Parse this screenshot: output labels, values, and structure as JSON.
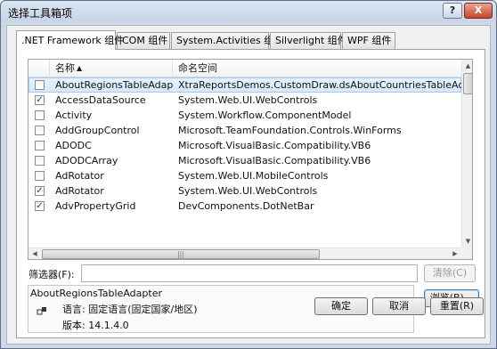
{
  "window": {
    "title": "选择工具箱项",
    "help": "?",
    "close": "X"
  },
  "tabs": [
    {
      "label": ".NET Framework 组件",
      "active": true
    },
    {
      "label": "COM 组件",
      "active": false
    },
    {
      "label": "System.Activities 组件",
      "active": false
    },
    {
      "label": "Silverlight 组件",
      "active": false
    },
    {
      "label": "WPF 组件",
      "active": false
    }
  ],
  "grid": {
    "columns": {
      "name": "名称",
      "namespace": "命名空间"
    },
    "rows": [
      {
        "checked": false,
        "name": "AboutRegionsTableAdapter",
        "namespace": "XtraReportsDemos.CustomDraw.dsAboutCountriesTableAdapters",
        "selected": true
      },
      {
        "checked": true,
        "name": "AccessDataSource",
        "namespace": "System.Web.UI.WebControls"
      },
      {
        "checked": false,
        "name": "Activity",
        "namespace": "System.Workflow.ComponentModel"
      },
      {
        "checked": false,
        "name": "AddGroupControl",
        "namespace": "Microsoft.TeamFoundation.Controls.WinForms"
      },
      {
        "checked": false,
        "name": "ADODC",
        "namespace": "Microsoft.VisualBasic.Compatibility.VB6"
      },
      {
        "checked": false,
        "name": "ADODCArray",
        "namespace": "Microsoft.VisualBasic.Compatibility.VB6"
      },
      {
        "checked": false,
        "name": "AdRotator",
        "namespace": "System.Web.UI.MobileControls"
      },
      {
        "checked": true,
        "name": "AdRotator",
        "namespace": "System.Web.UI.WebControls"
      },
      {
        "checked": true,
        "name": "AdvPropertyGrid",
        "namespace": "DevComponents.DotNetBar"
      }
    ],
    "vscroll_position": 0.0
  },
  "filter": {
    "label": "筛选器(F):",
    "value": "",
    "clear_button": "清除(C)"
  },
  "detail": {
    "title": "AboutRegionsTableAdapter",
    "language_line": "语言: 固定语言(固定国家/地区)",
    "version_line": "版本: 14.1.4.0",
    "browse_button": "浏览(B)..."
  },
  "buttons": {
    "ok": "确定",
    "cancel": "取消",
    "reset": "重置(R)"
  }
}
